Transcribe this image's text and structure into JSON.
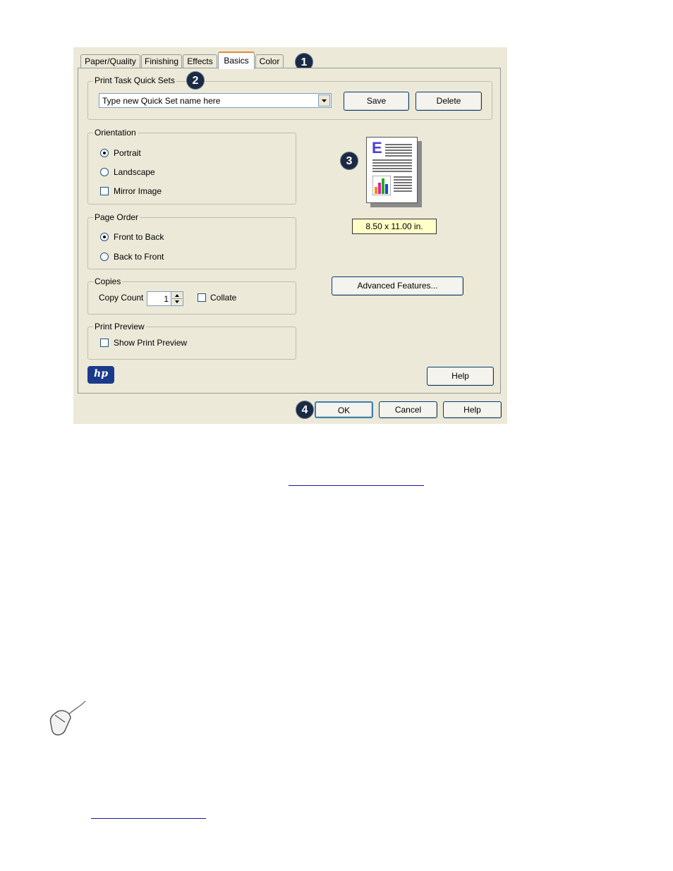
{
  "tabs": [
    {
      "label": "Paper/Quality"
    },
    {
      "label": "Finishing"
    },
    {
      "label": "Effects"
    },
    {
      "label": "Basics"
    },
    {
      "label": "Color"
    }
  ],
  "callouts": [
    "1",
    "2",
    "3",
    "4"
  ],
  "quick_sets": {
    "legend": "Print Task Quick Sets",
    "input_value": "Type new Quick Set name here",
    "save_label": "Save",
    "delete_label": "Delete"
  },
  "orientation": {
    "legend": "Orientation",
    "portrait": "Portrait",
    "landscape": "Landscape",
    "mirror": "Mirror Image"
  },
  "page_order": {
    "legend": "Page Order",
    "front_to_back": "Front to Back",
    "back_to_front": "Back to Front"
  },
  "copies": {
    "legend": "Copies",
    "copy_count_label": "Copy Count",
    "copy_count_value": "1",
    "collate": "Collate"
  },
  "print_preview": {
    "legend": "Print Preview",
    "show_print_preview": "Show Print Preview"
  },
  "preview": {
    "size_label": "8.50 x 11.00 in.",
    "page_letter": "E"
  },
  "advanced_features_label": "Advanced Features...",
  "help_label": "Help",
  "footer": {
    "ok": "OK",
    "cancel": "Cancel",
    "help": "Help"
  },
  "logo_text": "hp"
}
